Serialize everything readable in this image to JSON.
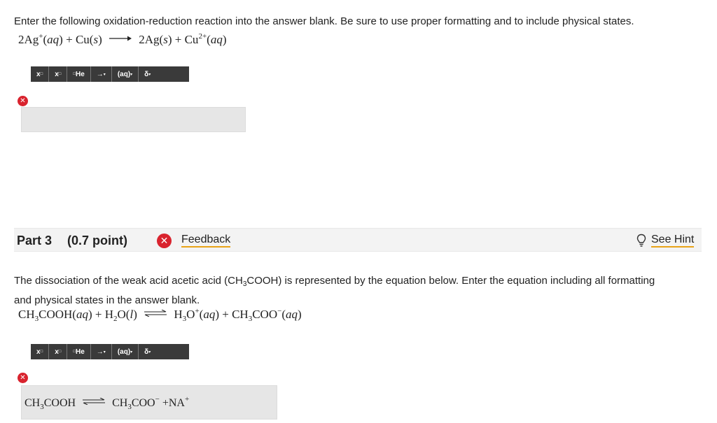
{
  "part2": {
    "instruction": "Enter the following oxidation-reduction reaction into the answer blank. Be sure to use proper formatting and to include physical states.",
    "equation": {
      "r1_coef": "2Ag",
      "r1_sup": "+",
      "r1_state": "aq",
      "plus1": "+",
      "r2": "Cu",
      "r2_state": "s",
      "p1": "2Ag",
      "p1_state": "s",
      "plus2": "+",
      "p2": "Cu",
      "p2_sup": "2+",
      "p2_state": "aq"
    }
  },
  "toolbar": {
    "superscript": "x",
    "subscript": "x",
    "isotope": "He",
    "arrow": "→",
    "state": "(aq)",
    "delta": "δ"
  },
  "part3": {
    "title": "Part 3",
    "points": "(0.7 point)",
    "feedback_label": "Feedback",
    "hint_label": "See Hint",
    "instruction_a": "The dissociation of the weak acid acetic acid (CH",
    "instruction_sub": "3",
    "instruction_b": "COOH) is represented by the equation below. Enter the equation including all formatting and physical states in the answer blank.",
    "equation": {
      "r1a": "CH",
      "r1sub": "3",
      "r1b": "COOH",
      "r1_state": "aq",
      "plus1": "+",
      "r2a": "H",
      "r2sub": "2",
      "r2b": "O",
      "r2_state": "l",
      "p1a": "H",
      "p1sub": "3",
      "p1b": "O",
      "p1sup": "+",
      "p1_state": "aq",
      "plus2": "+",
      "p2a": "CH",
      "p2sub": "3",
      "p2b": "COO",
      "p2sup": "−",
      "p2_state": "aq"
    },
    "answer": {
      "r1a": "CH",
      "r1sub": "3",
      "r1b": "COOH",
      "p1a": "CH",
      "p1sub": "3",
      "p1b": "COO",
      "p1sup": "−",
      "plus": "+",
      "p2": "NA",
      "p2sup": "+"
    }
  },
  "colors": {
    "error_red": "#d9232e",
    "link_underline": "#e8a317",
    "toolbar_bg": "#3a3a3a"
  }
}
